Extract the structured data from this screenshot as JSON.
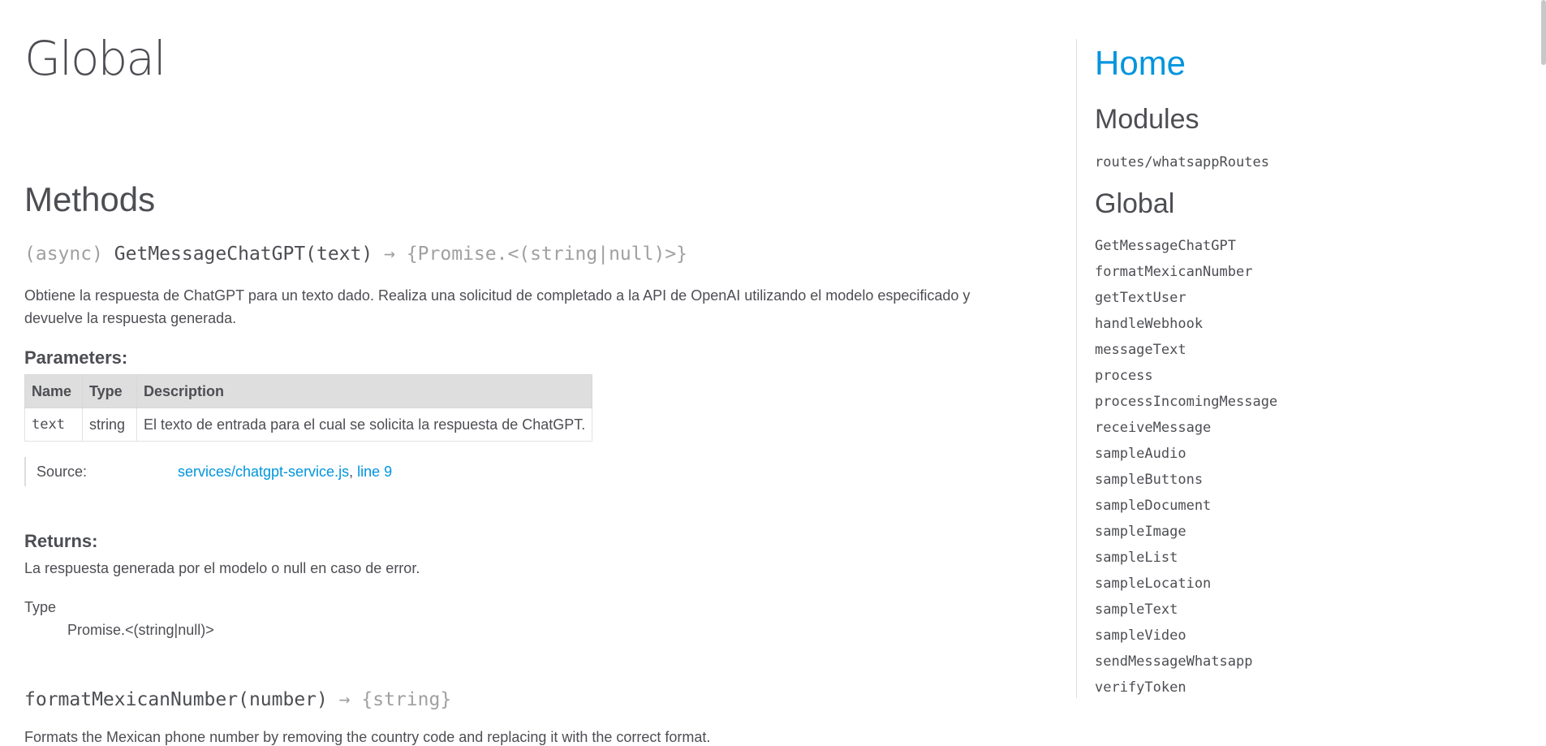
{
  "page": {
    "title": "Global"
  },
  "methods": {
    "title": "Methods",
    "m1": {
      "attr": "(async) ",
      "name": "GetMessageChatGPT(text)",
      "arrow": " → ",
      "returns": "{Promise.<(string|null)>}",
      "description": "Obtiene la respuesta de ChatGPT para un texto dado. Realiza una solicitud de completado a la API de OpenAI utilizando el modelo especificado y devuelve la respuesta generada.",
      "params_title": "Parameters:",
      "params_headers": [
        "Name",
        "Type",
        "Description"
      ],
      "params_rows": [
        [
          "text",
          "string",
          "El texto de entrada para el cual se solicita la respuesta de ChatGPT."
        ]
      ],
      "source_label": "Source:",
      "source_file": "services/chatgpt-service.js",
      "source_sep": ", ",
      "source_line": "line 9",
      "returns_title": "Returns:",
      "returns_desc": "La respuesta generada por el modelo o null en caso de error.",
      "type_label": "Type",
      "type_value": "Promise.<(string|null)>"
    },
    "m2": {
      "name": "formatMexicanNumber(number)",
      "arrow": " → ",
      "returns": "{string}",
      "description": "Formats the Mexican phone number by removing the country code and replacing it with the correct format."
    }
  },
  "nav": {
    "home": "Home",
    "modules_title": "Modules",
    "modules": [
      "routes/whatsappRoutes"
    ],
    "global_title": "Global",
    "global_items": [
      "GetMessageChatGPT",
      "formatMexicanNumber",
      "getTextUser",
      "handleWebhook",
      "messageText",
      "process",
      "processIncomingMessage",
      "receiveMessage",
      "sampleAudio",
      "sampleButtons",
      "sampleDocument",
      "sampleImage",
      "sampleList",
      "sampleLocation",
      "sampleText",
      "sampleVideo",
      "sendMessageWhatsapp",
      "verifyToken"
    ]
  },
  "colors": {
    "link": "#0095dd",
    "text": "#4d4e53",
    "muted": "#a0a0a0",
    "table_header": "#dedede"
  }
}
